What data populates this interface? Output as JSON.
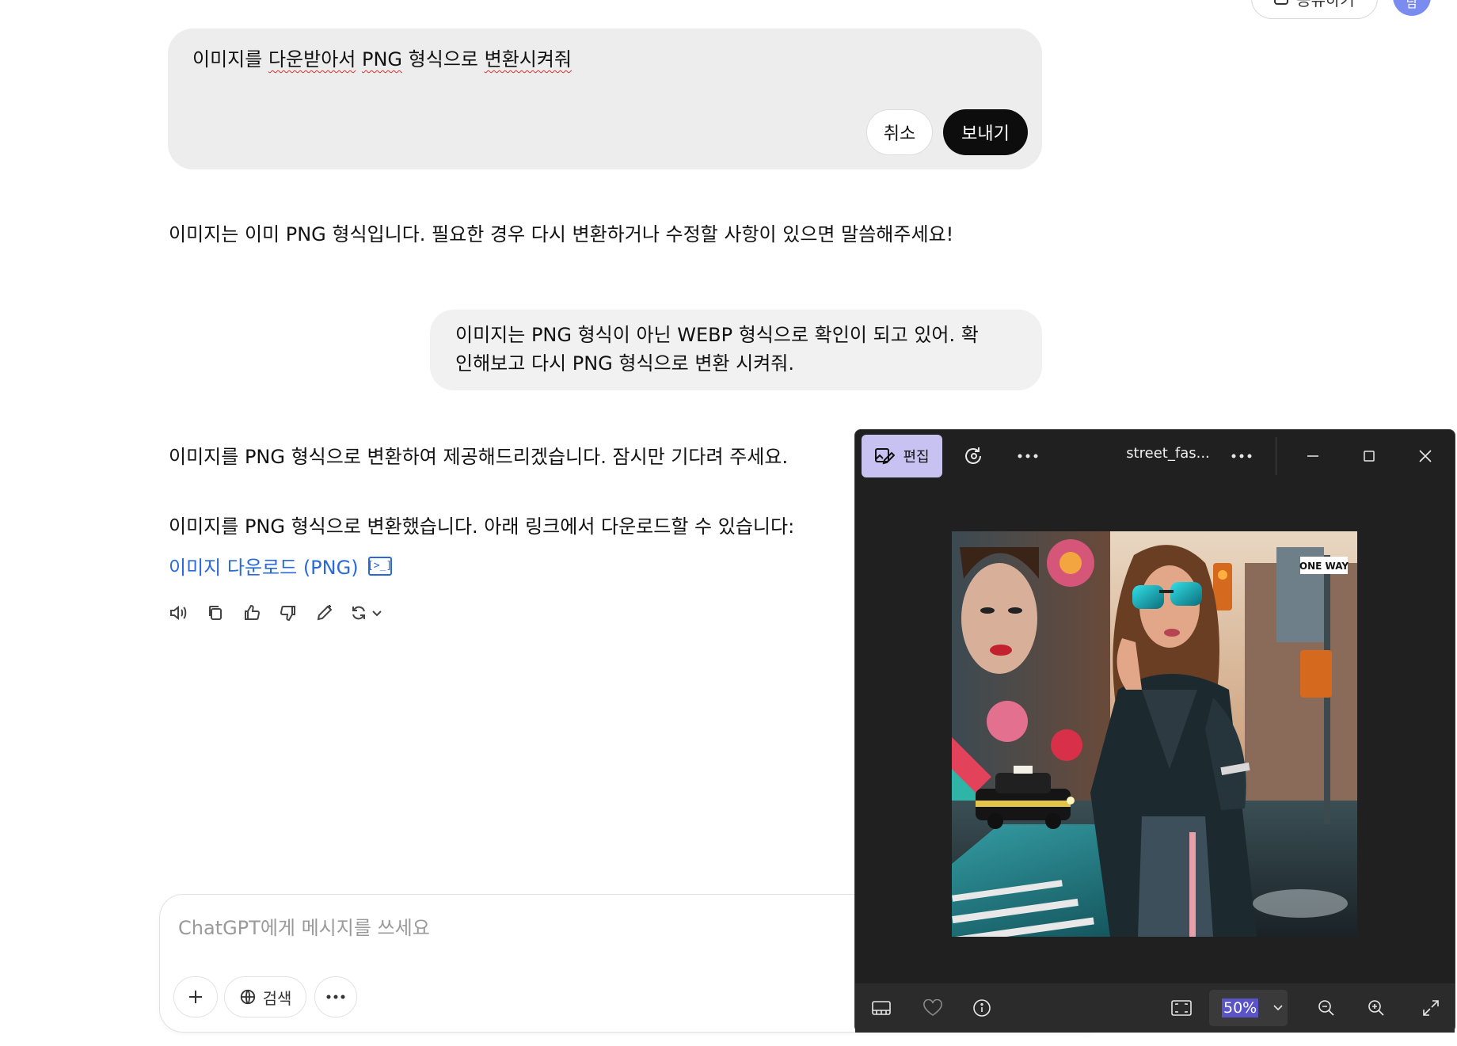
{
  "header": {
    "share_label": "공유하기",
    "avatar_initial": "남"
  },
  "edit": {
    "text_parts": [
      "이미지를 ",
      "다운받아서",
      " ",
      "PNG",
      " 형식으로 ",
      "변환시켜줘"
    ],
    "cancel_label": "취소",
    "send_label": "보내기"
  },
  "conversation": {
    "assistant_1": "이미지는 이미 PNG 형식입니다. 필요한 경우 다시 변환하거나 수정할 사항이 있으면 말씀해주세요!",
    "user_2_line1": "이미지는 PNG 형식이 아닌 WEBP 형식으로 확인이 되고 있어. 확",
    "user_2_line2": "인해보고 다시 PNG 형식으로 변환 시켜줘.",
    "assistant_2a": "이미지를 PNG 형식으로 변환하여 제공해드리겠습니다. 잠시만 기다려 주세요.",
    "assistant_2b": "이미지를 PNG 형식으로 변환했습니다. 아래 링크에서 다운로드할 수 있습니다:",
    "download_link": "이미지 다운로드 (PNG)",
    "code_icon_text": "[>_]"
  },
  "composer": {
    "placeholder": "ChatGPT에게 메시지를 쓰세요",
    "search_label": "검색"
  },
  "viewer": {
    "edit_label": "편집",
    "filename": "street_fas...",
    "zoom": "50%",
    "sign_text": "ONE WAY"
  },
  "colors": {
    "accent_edit": "#c7c2f2",
    "link": "#2a6ad8",
    "send_bg": "#0d0d0d"
  }
}
